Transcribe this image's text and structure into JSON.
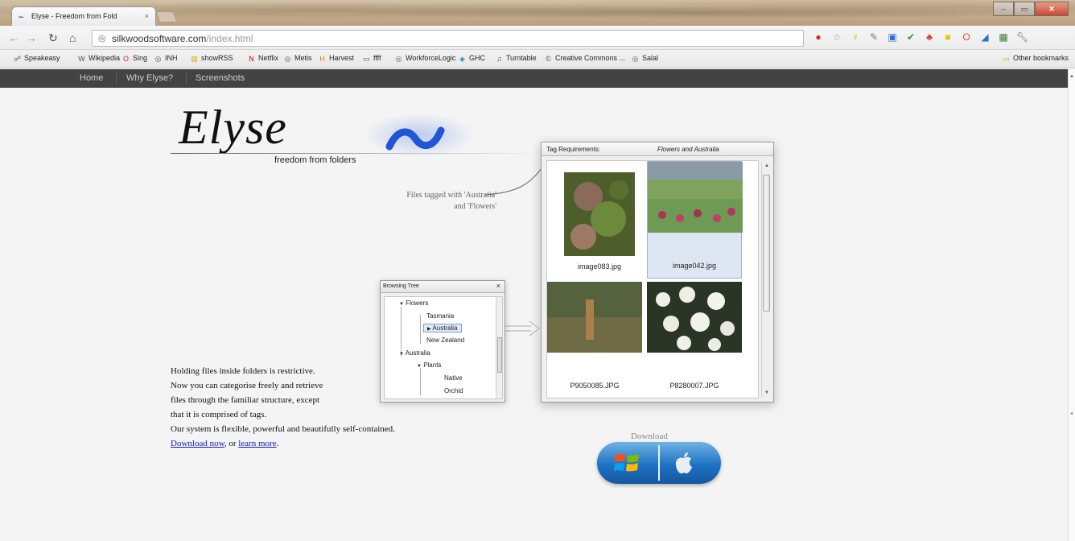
{
  "browser": {
    "tab_title": "Elyse - Freedom from Fold",
    "tab_close": "×",
    "window_controls": [
      "–",
      "▭",
      "✕"
    ],
    "address_host": "silkwoodsoftware.com",
    "address_path": "/index.html",
    "bookmarks": [
      {
        "label": "Speakeasy",
        "icon": "link-icon"
      },
      {
        "label": "Wikipedia",
        "icon": "wikipedia-icon"
      },
      {
        "label": "Sing",
        "icon": "opera-icon"
      },
      {
        "label": "INH",
        "icon": "globe-icon"
      },
      {
        "label": "showRSS",
        "icon": "rss-icon"
      },
      {
        "label": "Netflix",
        "icon": "netflix-icon"
      },
      {
        "label": "Metis",
        "icon": "globe-icon"
      },
      {
        "label": "Harvest",
        "icon": "harvest-icon"
      },
      {
        "label": "ffff",
        "icon": "page-icon"
      },
      {
        "label": "WorkforceLogic",
        "icon": "globe-icon"
      },
      {
        "label": "GHC",
        "icon": "ghc-icon"
      },
      {
        "label": "Turntable",
        "icon": "headphones-icon"
      },
      {
        "label": "Creative Commons ...",
        "icon": "cc-icon"
      },
      {
        "label": "Salal",
        "icon": "globe-icon"
      }
    ],
    "other_bookmarks": "Other bookmarks"
  },
  "site_nav": [
    "Home",
    "Why Elyse?",
    "Screenshots"
  ],
  "hero": {
    "logo": "Elyse",
    "tagline": "freedom from folders",
    "annotation_line1": "Files tagged with 'Australia'",
    "annotation_line2": "and 'Flowers'"
  },
  "main_window": {
    "header_left": "Tag Requirements:",
    "header_right": "Flowers and Australia",
    "files": [
      {
        "name": "image083.jpg",
        "selected": false,
        "colors": [
          "#6a7a3c",
          "#9a6e62"
        ]
      },
      {
        "name": "image042.jpg",
        "selected": true,
        "colors": [
          "#5f8a4a",
          "#b43b5e"
        ]
      },
      {
        "name": "P9050085.JPG",
        "selected": false,
        "colors": [
          "#5f6645",
          "#9b7a4a"
        ]
      },
      {
        "name": "P8280007.JPG",
        "selected": false,
        "colors": [
          "#2e3a28",
          "#f2f2ee"
        ]
      }
    ]
  },
  "tree_window": {
    "title": "Browsing Tree",
    "close": "×",
    "nodes": {
      "flowers": "Flowers",
      "tasmania": "Tasmania",
      "australia_sel": "Australia",
      "new_zealand": "New Zealand",
      "australia": "Australia",
      "plants": "Plants",
      "native": "Native",
      "orchid": "Orchid"
    }
  },
  "body": {
    "line1": "Holding files inside folders is restrictive.",
    "line2": "Now you can categorise freely and retrieve",
    "line3": "files through the familiar structure, except",
    "line4": "that it is comprised of tags.",
    "line5": "Our system is flexible, powerful and beautifully self-contained.",
    "download_link": "Download now",
    "connector": ", or ",
    "learn_link": "learn more",
    "end": "."
  },
  "download": {
    "label": "Download",
    "windows_icon": "windows-logo-icon",
    "apple_icon": "apple-logo-icon"
  }
}
